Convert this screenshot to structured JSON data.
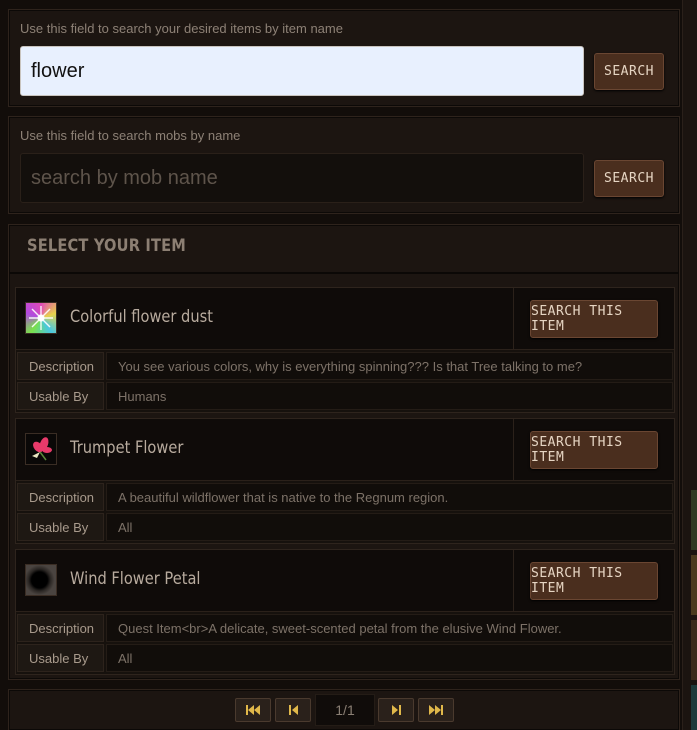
{
  "item_search": {
    "hint": "Use this field to search your desired items by item name",
    "value": "flower",
    "button_label": "SEARCH"
  },
  "mob_search": {
    "hint": "Use this field to search mobs by name",
    "value": "",
    "placeholder": "search by mob name",
    "button_label": "SEARCH"
  },
  "results": {
    "title": "SELECT YOUR ITEM",
    "description_label": "Description",
    "usable_by_label": "Usable By",
    "search_button_label": "SEARCH THIS ITEM",
    "items": [
      {
        "name": "Colorful flower dust",
        "icon": "colorful-flower-dust-icon",
        "description": "You see various colors, why is everything spinning??? Is that Tree talking to me?",
        "usable_by": "Humans"
      },
      {
        "name": "Trumpet Flower",
        "icon": "trumpet-flower-icon",
        "description": "A beautiful wildflower that is native to the Regnum region.",
        "usable_by": "All"
      },
      {
        "name": "Wind Flower Petal",
        "icon": "wind-flower-petal-icon",
        "description": "Quest Item<br>A delicate, sweet-scented petal from the elusive Wind Flower.",
        "usable_by": "All"
      }
    ]
  },
  "pagination": {
    "page_indicator": "1/1",
    "buttons": [
      "first-page-icon",
      "previous-page-icon",
      "next-page-icon",
      "last-page-icon"
    ]
  },
  "colors": {
    "background": "#120d0a",
    "panel": "#1c1511",
    "button": "#4a2e1e",
    "button_text": "#e6d5c3",
    "pager_arrow": "#e0b84a"
  }
}
